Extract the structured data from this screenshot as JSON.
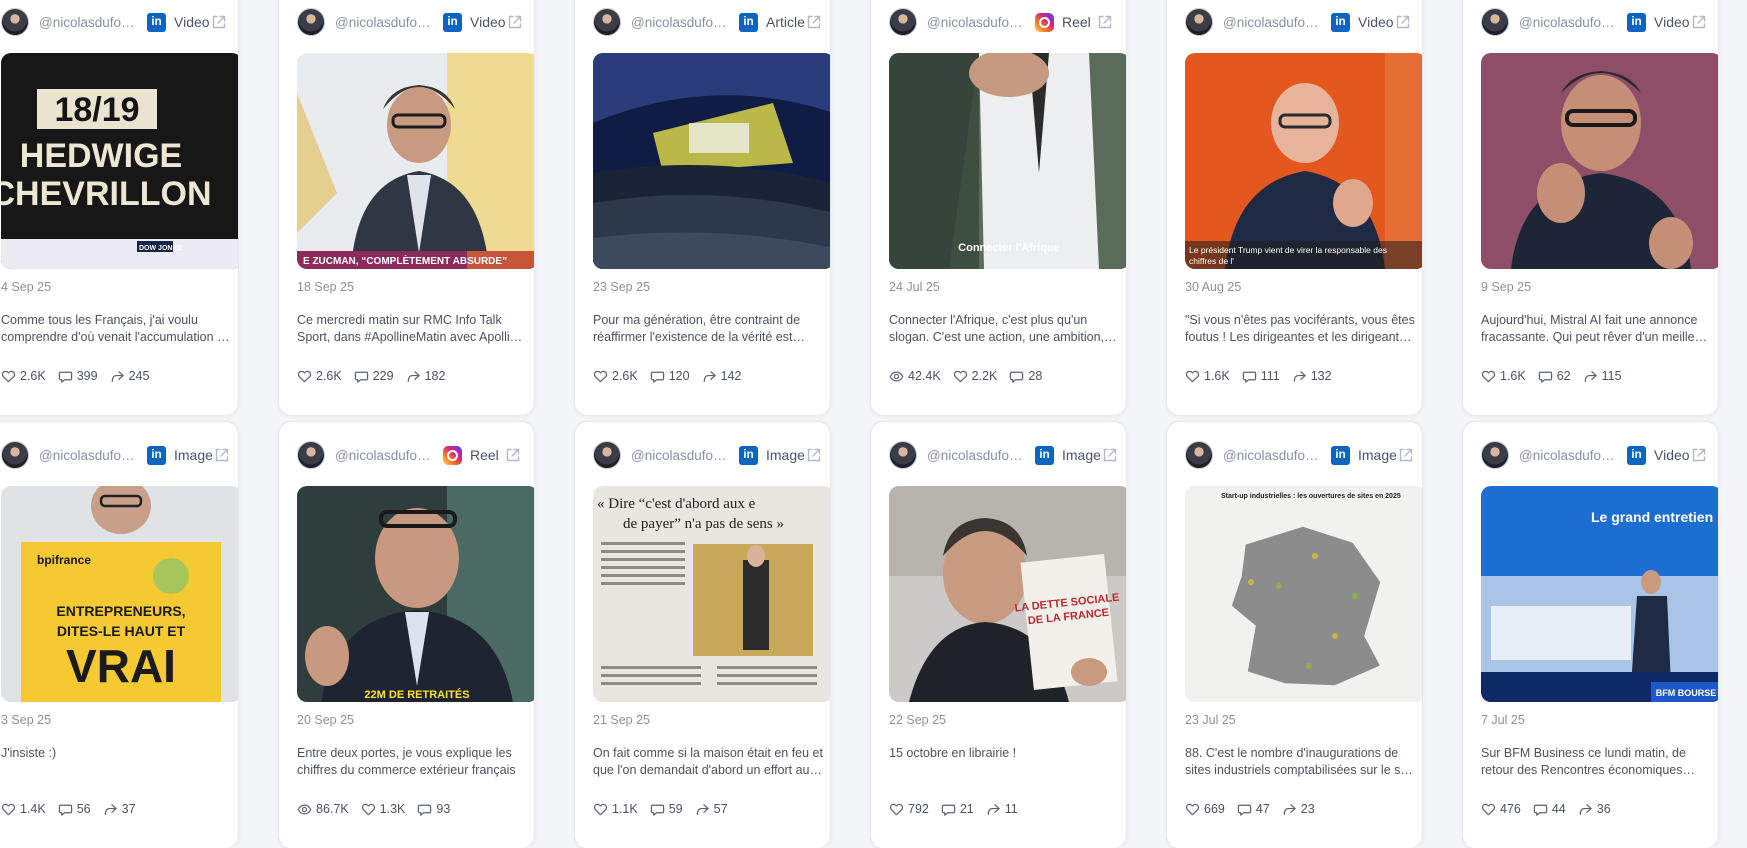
{
  "colors": {
    "linkedin": "#0a66c2",
    "instagram": "#d62976",
    "text_muted": "#8a90a0",
    "card_bg": "#ffffff",
    "page_bg": "#f3f5f9"
  },
  "posts": [
    {
      "handle": "@nicolasdufourcq",
      "platform": "linkedin",
      "platform_icon": "linkedin-icon",
      "type": "Video",
      "thumb_text": [
        "18/19",
        "HEDWIGE",
        "CHEVRILLON",
        "DOW JONES"
      ],
      "date": "4 Sep 25",
      "caption": "Comme tous les Français, j'ai voulu comprendre d'où venait l'accumulation de la dette",
      "stats": [
        {
          "kind": "likes",
          "value": "2.6K"
        },
        {
          "kind": "comments",
          "value": "399"
        },
        {
          "kind": "shares",
          "value": "245"
        }
      ]
    },
    {
      "handle": "@nicolasdufourcq",
      "platform": "linkedin",
      "platform_icon": "linkedin-icon",
      "type": "Video",
      "thumb_text": [
        "E ZUCMAN, “COMPLÈTEMENT ABSURDE”"
      ],
      "date": "18 Sep 25",
      "caption": "Ce mercredi matin sur RMC Info Talk Sport, dans #ApollineMatin avec Apolline de Malherbe",
      "stats": [
        {
          "kind": "likes",
          "value": "2.6K"
        },
        {
          "kind": "comments",
          "value": "229"
        },
        {
          "kind": "shares",
          "value": "182"
        }
      ]
    },
    {
      "handle": "@nicolasdufourcq",
      "platform": "linkedin",
      "platform_icon": "linkedin-icon",
      "type": "Article",
      "thumb_text": [],
      "date": "23 Sep 25",
      "caption": "Pour ma génération, être contraint de réaffirmer l'existence de la vérité est terrible",
      "stats": [
        {
          "kind": "likes",
          "value": "2.6K"
        },
        {
          "kind": "comments",
          "value": "120"
        },
        {
          "kind": "shares",
          "value": "142"
        }
      ]
    },
    {
      "handle": "@nicolasdufourcq",
      "platform": "instagram",
      "platform_icon": "instagram-icon",
      "type": "Reel",
      "thumb_text": [
        "Connecter l'Afrique"
      ],
      "date": "24 Jul 25",
      "caption": "Connecter l'Afrique, c'est plus qu'un slogan. C'est une action, une ambition, un projet",
      "stats": [
        {
          "kind": "views",
          "value": "42.4K"
        },
        {
          "kind": "likes",
          "value": "2.2K"
        },
        {
          "kind": "comments",
          "value": "28"
        }
      ]
    },
    {
      "handle": "@nicolasdufourcq",
      "platform": "linkedin",
      "platform_icon": "linkedin-icon",
      "type": "Video",
      "thumb_text": [
        "Le président Trump vient de virer la responsable des chiffres de l'"
      ],
      "date": "30 Aug 25",
      "caption": "\"Si vous n'êtes pas vociférants, vous êtes foutus ! Les dirigeantes et les dirigeants doivent",
      "stats": [
        {
          "kind": "likes",
          "value": "1.6K"
        },
        {
          "kind": "comments",
          "value": "111"
        },
        {
          "kind": "shares",
          "value": "132"
        }
      ]
    },
    {
      "handle": "@nicolasdufourcq",
      "platform": "linkedin",
      "platform_icon": "linkedin-icon",
      "type": "Video",
      "thumb_text": [],
      "date": "9 Sep 25",
      "caption": "Aujourd'hui, Mistral AI fait une annonce fracassante. Qui peut rêver d'un meilleur signal",
      "stats": [
        {
          "kind": "likes",
          "value": "1.6K"
        },
        {
          "kind": "comments",
          "value": "62"
        },
        {
          "kind": "shares",
          "value": "115"
        }
      ]
    },
    {
      "handle": "@nicolasdufourcq",
      "platform": "linkedin",
      "platform_icon": "linkedin-icon",
      "type": "Image",
      "thumb_text": [
        "bpifrance",
        "ENTREPRENEURS,",
        "DITES-LE HAUT ET",
        "VRAI"
      ],
      "date": "3 Sep 25",
      "caption": "J'insiste :)",
      "stats": [
        {
          "kind": "likes",
          "value": "1.4K"
        },
        {
          "kind": "comments",
          "value": "56"
        },
        {
          "kind": "shares",
          "value": "37"
        }
      ]
    },
    {
      "handle": "@nicolasdufourcq",
      "platform": "instagram",
      "platform_icon": "instagram-icon",
      "type": "Reel",
      "thumb_text": [
        "22M DE RETRAITÉS"
      ],
      "date": "20 Sep 25",
      "caption": "Entre deux portes, je vous explique les chiffres du commerce extérieur français",
      "stats": [
        {
          "kind": "views",
          "value": "86.7K"
        },
        {
          "kind": "likes",
          "value": "1.3K"
        },
        {
          "kind": "comments",
          "value": "93"
        }
      ]
    },
    {
      "handle": "@nicolasdufourcq",
      "platform": "linkedin",
      "platform_icon": "linkedin-icon",
      "type": "Image",
      "thumb_text": [
        "« Dire “c'est d'abord aux e",
        "de payer” n'a pas de sens »"
      ],
      "date": "21 Sep 25",
      "caption": "On fait comme si la maison était en feu et que l'on demandait d'abord un effort aux autres",
      "stats": [
        {
          "kind": "likes",
          "value": "1.1K"
        },
        {
          "kind": "comments",
          "value": "59"
        },
        {
          "kind": "shares",
          "value": "57"
        }
      ]
    },
    {
      "handle": "@nicolasdufourcq",
      "platform": "linkedin",
      "platform_icon": "linkedin-icon",
      "type": "Image",
      "thumb_text": [
        "LA DETTE SOCIALE",
        "DE LA FRANCE"
      ],
      "date": "22 Sep 25",
      "caption": "15 octobre en librairie !",
      "stats": [
        {
          "kind": "likes",
          "value": "792"
        },
        {
          "kind": "comments",
          "value": "21"
        },
        {
          "kind": "shares",
          "value": "11"
        }
      ]
    },
    {
      "handle": "@nicolasdufourcq",
      "platform": "linkedin",
      "platform_icon": "linkedin-icon",
      "type": "Image",
      "thumb_text": [
        "Start-up industrielles : les ouvertures de sites en 2025"
      ],
      "date": "23 Jul 25",
      "caption": "88. C'est le nombre d'inaugurations de sites industriels comptabilisées sur le sol français",
      "stats": [
        {
          "kind": "likes",
          "value": "669"
        },
        {
          "kind": "comments",
          "value": "47"
        },
        {
          "kind": "shares",
          "value": "23"
        }
      ]
    },
    {
      "handle": "@nicolasdufourcq",
      "platform": "linkedin",
      "platform_icon": "linkedin-icon",
      "type": "Video",
      "thumb_text": [
        "Le grand entretien",
        "BFM BOURSE"
      ],
      "date": "7 Jul 25",
      "caption": "Sur BFM Business ce lundi matin, de retour des Rencontres économiques d'Aix",
      "stats": [
        {
          "kind": "likes",
          "value": "476"
        },
        {
          "kind": "comments",
          "value": "44"
        },
        {
          "kind": "shares",
          "value": "36"
        }
      ]
    }
  ]
}
